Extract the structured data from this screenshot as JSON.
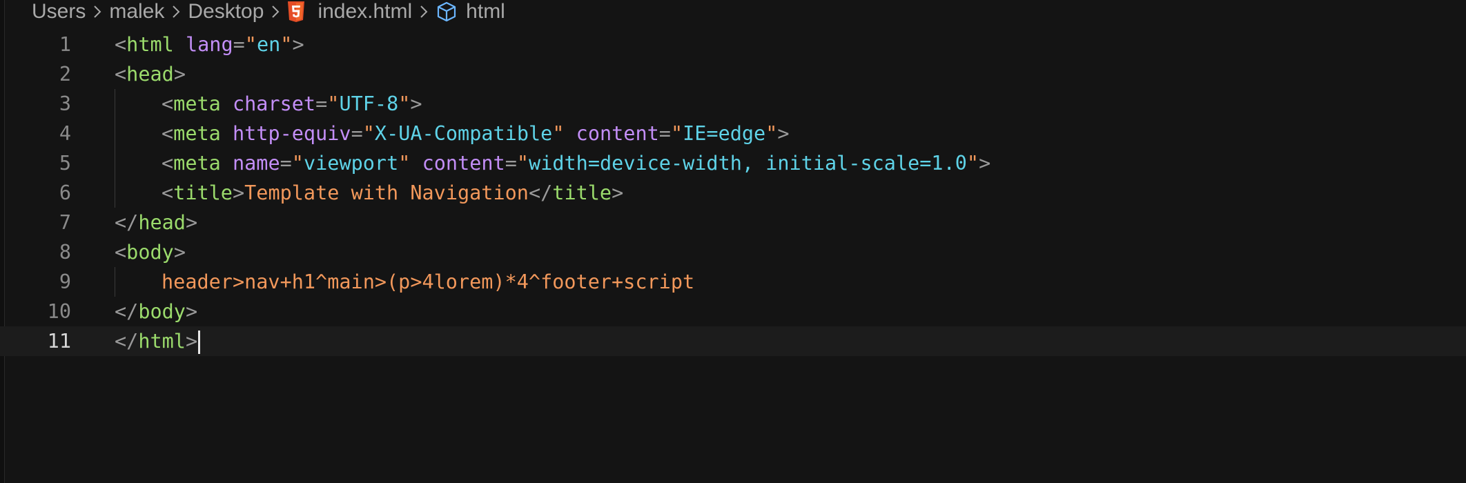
{
  "breadcrumb": {
    "items": [
      "Users",
      "malek",
      "Desktop",
      "index.html",
      "html"
    ]
  },
  "colors": {
    "background": "#141414",
    "tag": "#9bdb6c",
    "attribute": "#c38ef7",
    "string": "#5fd3e8",
    "text": "#f2985b",
    "punctuation": "#9a9a9a",
    "html5_icon": "#e44d26"
  },
  "editor": {
    "current_line": 11,
    "lines": [
      {
        "number": "1",
        "tokens": [
          [
            "p",
            "<"
          ],
          [
            "t",
            "html"
          ],
          [
            "w",
            " "
          ],
          [
            "a",
            "lang"
          ],
          [
            "p",
            "="
          ],
          [
            "o",
            "\""
          ],
          [
            "s",
            "en"
          ],
          [
            "o",
            "\""
          ],
          [
            "p",
            ">"
          ]
        ]
      },
      {
        "number": "2",
        "tokens": [
          [
            "p",
            "<"
          ],
          [
            "t",
            "head"
          ],
          [
            "p",
            ">"
          ]
        ]
      },
      {
        "number": "3",
        "indent": 1,
        "tokens": [
          [
            "p",
            "<"
          ],
          [
            "t",
            "meta"
          ],
          [
            "w",
            " "
          ],
          [
            "a",
            "charset"
          ],
          [
            "p",
            "="
          ],
          [
            "o",
            "\""
          ],
          [
            "s",
            "UTF-8"
          ],
          [
            "o",
            "\""
          ],
          [
            "p",
            ">"
          ]
        ]
      },
      {
        "number": "4",
        "indent": 1,
        "tokens": [
          [
            "p",
            "<"
          ],
          [
            "t",
            "meta"
          ],
          [
            "w",
            " "
          ],
          [
            "a",
            "http-equiv"
          ],
          [
            "p",
            "="
          ],
          [
            "o",
            "\""
          ],
          [
            "s",
            "X-UA-Compatible"
          ],
          [
            "o",
            "\""
          ],
          [
            "w",
            " "
          ],
          [
            "a",
            "content"
          ],
          [
            "p",
            "="
          ],
          [
            "o",
            "\""
          ],
          [
            "s",
            "IE=edge"
          ],
          [
            "o",
            "\""
          ],
          [
            "p",
            ">"
          ]
        ]
      },
      {
        "number": "5",
        "indent": 1,
        "tokens": [
          [
            "p",
            "<"
          ],
          [
            "t",
            "meta"
          ],
          [
            "w",
            " "
          ],
          [
            "a",
            "name"
          ],
          [
            "p",
            "="
          ],
          [
            "o",
            "\""
          ],
          [
            "s",
            "viewport"
          ],
          [
            "o",
            "\""
          ],
          [
            "w",
            " "
          ],
          [
            "a",
            "content"
          ],
          [
            "p",
            "="
          ],
          [
            "o",
            "\""
          ],
          [
            "s",
            "width=device-width, initial-scale=1.0"
          ],
          [
            "o",
            "\""
          ],
          [
            "p",
            ">"
          ]
        ]
      },
      {
        "number": "6",
        "indent": 1,
        "tokens": [
          [
            "p",
            "<"
          ],
          [
            "t",
            "title"
          ],
          [
            "p",
            ">"
          ],
          [
            "o",
            "Template with Navigation"
          ],
          [
            "p",
            "</"
          ],
          [
            "t",
            "title"
          ],
          [
            "p",
            ">"
          ]
        ]
      },
      {
        "number": "7",
        "tokens": [
          [
            "p",
            "</"
          ],
          [
            "t",
            "head"
          ],
          [
            "p",
            ">"
          ]
        ]
      },
      {
        "number": "8",
        "tokens": [
          [
            "p",
            "<"
          ],
          [
            "t",
            "body"
          ],
          [
            "p",
            ">"
          ]
        ]
      },
      {
        "number": "9",
        "indent": 1,
        "tokens": [
          [
            "o",
            "header>nav+h1^main>(p>4lorem)*4^footer+script"
          ]
        ]
      },
      {
        "number": "10",
        "tokens": [
          [
            "p",
            "</"
          ],
          [
            "t",
            "body"
          ],
          [
            "p",
            ">"
          ]
        ]
      },
      {
        "number": "11",
        "tokens": [
          [
            "p",
            "</"
          ],
          [
            "t",
            "html"
          ],
          [
            "p",
            ">"
          ]
        ],
        "caret": true
      }
    ]
  }
}
